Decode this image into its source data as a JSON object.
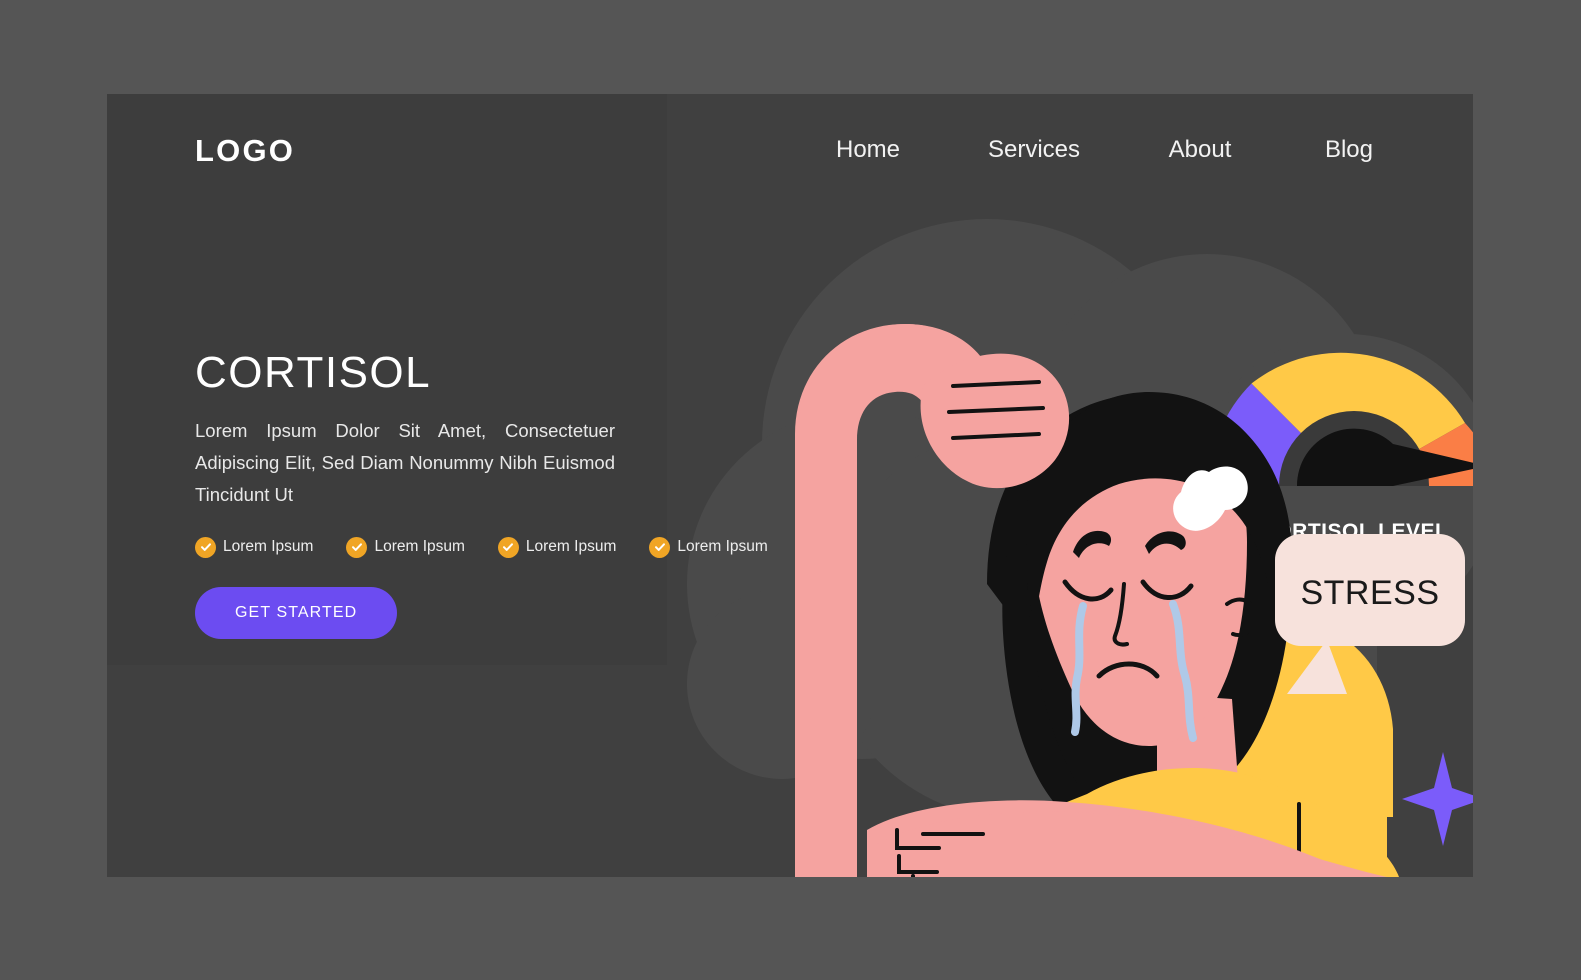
{
  "brand": {
    "logo": "LOGO"
  },
  "nav": {
    "items": [
      {
        "label": "Home"
      },
      {
        "label": "Services"
      },
      {
        "label": "About"
      },
      {
        "label": "Blog"
      }
    ]
  },
  "hero": {
    "headline": "CORTISOL",
    "subcopy": "Lorem Ipsum Dolor Sit Amet, Consectetuer Adipiscing Elit, Sed Diam Nonummy Nibh Euismod Tincidunt Ut",
    "features": [
      {
        "label": "Lorem Ipsum"
      },
      {
        "label": "Lorem Ipsum"
      },
      {
        "label": "Lorem Ipsum"
      },
      {
        "label": "Lorem Ipsum"
      }
    ],
    "cta_label": "GET STARTED"
  },
  "illustration": {
    "gauge": {
      "caption": "CORTISOL LEVEL",
      "segments": [
        {
          "name": "low",
          "color": "#7B5CFA"
        },
        {
          "name": "medium",
          "color": "#FFC947"
        },
        {
          "name": "high",
          "color": "#FA7E46"
        }
      ],
      "needle_zone": "high"
    },
    "speech_bubble": {
      "text": "STRESS"
    },
    "sparkles": [
      {
        "name": "sparkle-small-yellow",
        "color": "#FFC947"
      },
      {
        "name": "sparkle-large-orange",
        "color": "#FA8A46"
      },
      {
        "name": "sparkle-purple",
        "color": "#7B5CFA"
      }
    ]
  },
  "colors": {
    "outer_background": "#555555",
    "page_background": "#404040",
    "hero_band": "#3d3d3d",
    "cloud_blob": "#4a4a4a",
    "accent_purple": "#6C4CF1",
    "accent_amber": "#F0A525",
    "skin": "#F5A3A0",
    "shirt": "#FFC947",
    "hair": "#121212",
    "bubble": "#F7E2DC",
    "tear": "#AFC9E8"
  }
}
